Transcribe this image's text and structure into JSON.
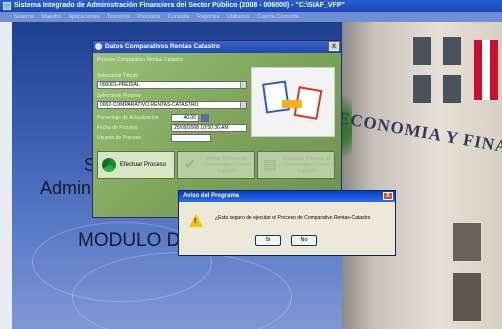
{
  "window": {
    "title": "Sistema Integrado de Administración Financiera del Sector Público (2008 - 006000) - \"C:\\SIAF_VFP\"",
    "menu": [
      "Sistema",
      "Maestro",
      "Aplicaciones",
      "Tesorería",
      "Procesos",
      "Consulta",
      "Reportes",
      "Utilitarios",
      "Cuenta Corriente"
    ]
  },
  "background": {
    "label_s": "S",
    "label_admin": "Admin",
    "label_modulo": "MODULO D",
    "building_sign": "ECONOMIA Y FINANZAS"
  },
  "dialog": {
    "title": "Datos Comparativos Rentas Catastro",
    "header_label": "Proceso Comparativo Rentas-Catastro",
    "tipo_label": "Seleccione Tributo",
    "tipo_value": "000001-PREDIAL",
    "proceso_label": "Seleccione Proceso",
    "proceso_value": "0002-COMPARATIVO RENTAS-CATASTRO",
    "porcentaje_label": "Porcentaje de Actualización",
    "porcentaje_value": "40.00",
    "fecha_label": "Fecha de Proceso",
    "fecha_value": "25/09/2008 10:50:36 AM",
    "ultimo_label": "Usuario de Proceso",
    "btn_efectuar": "Efectuar Proceso",
    "btn_anular": "Anular Proceso de Comparativo Rentas-Catastro",
    "btn_actualizar": "Actualizar Proceso de Comparativo Rentas-Catastro",
    "close": "X"
  },
  "aviso": {
    "title": "Aviso del Programa",
    "message": "¿Esta seguro de ejecutar el Proceso de Comparativo Rentas-Catastro",
    "btn_si": "Si",
    "btn_no": "No",
    "close": "X"
  }
}
